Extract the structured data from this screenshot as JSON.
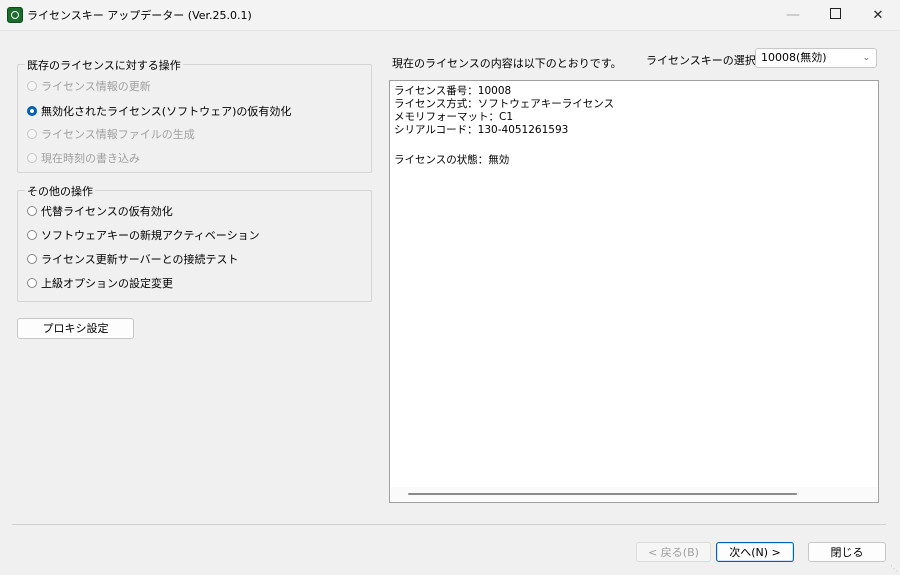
{
  "window": {
    "title": "ライセンスキー アップデーター (Ver.25.0.1)",
    "controls": {
      "minimize": "—",
      "maximize": "",
      "close": ""
    }
  },
  "existing_ops": {
    "legend": "既存のライセンスに対する操作",
    "options": [
      {
        "label": "ライセンス情報の更新",
        "state": "disabled"
      },
      {
        "label": "無効化されたライセンス(ソフトウェア)の仮有効化",
        "state": "checked"
      },
      {
        "label": "ライセンス情報ファイルの生成",
        "state": "disabled"
      },
      {
        "label": "現在時刻の書き込み",
        "state": "disabled"
      }
    ]
  },
  "other_ops": {
    "legend": "その他の操作",
    "options": [
      {
        "label": "代替ライセンスの仮有効化"
      },
      {
        "label": "ソフトウェアキーの新規アクティベーション"
      },
      {
        "label": "ライセンス更新サーバーとの接続テスト"
      },
      {
        "label": "上級オプションの設定変更"
      }
    ]
  },
  "proxy_button": "プロキシ設定",
  "right": {
    "heading": "現在のライセンスの内容は以下のとおりです。",
    "select_label": "ライセンスキーの選択",
    "select_value": "10008(無効)",
    "details": [
      "ライセンス番号：10008",
      "ライセンス方式：ソフトウェアキーライセンス",
      "メモリフォーマット：C1",
      "シリアルコード：130-4051261593",
      "",
      "ライセンスの状態：無効"
    ]
  },
  "footer": {
    "back": "< 戻る(B)",
    "next": "次へ(N) >",
    "close": "閉じる"
  }
}
